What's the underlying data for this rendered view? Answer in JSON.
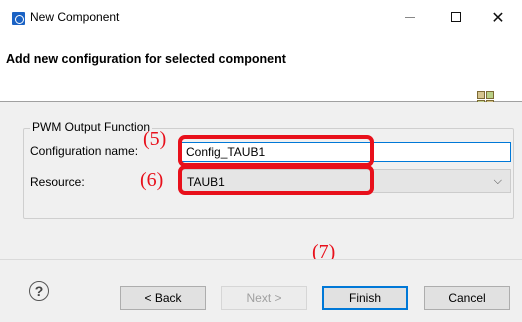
{
  "window": {
    "title": "New Component"
  },
  "header": {
    "title": "Add new configuration for selected component"
  },
  "form": {
    "group_label": "PWM Output Function",
    "config_name_label": "Configuration name:",
    "config_name_value": "Config_TAUB1",
    "resource_label": "Resource:",
    "resource_value": "TAUB1"
  },
  "annotations": {
    "n5": "(5)",
    "n6": "(6)",
    "n7": "(7)",
    "color": "#e8101b"
  },
  "buttons": {
    "help": "?",
    "back": "< Back",
    "next": "Next >",
    "finish": "Finish",
    "cancel": "Cancel"
  }
}
